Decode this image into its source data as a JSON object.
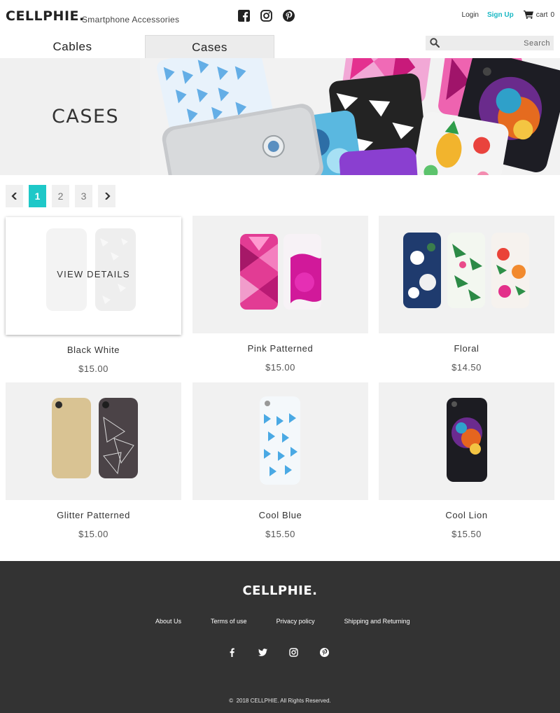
{
  "brand": {
    "name": "CELLPHIE.",
    "tagline": "Smartphone Accessories"
  },
  "header": {
    "social_icons": [
      "facebook-icon",
      "instagram-icon",
      "pinterest-icon"
    ],
    "login_label": "Login",
    "signup_label": "Sign Up",
    "cart_label": "cart",
    "cart_count": "0"
  },
  "tabs": [
    {
      "label": "Cables",
      "active": false
    },
    {
      "label": "Cases",
      "active": true
    }
  ],
  "search": {
    "placeholder": "Search",
    "value": ""
  },
  "banner": {
    "title": "CASES"
  },
  "pagination": {
    "pages": [
      "1",
      "2",
      "3"
    ],
    "current": "1"
  },
  "products": [
    {
      "name": "Black White",
      "price": "$15.00",
      "hover_label": "VIEW DETAILS"
    },
    {
      "name": "Pink Patterned",
      "price": "$15.00"
    },
    {
      "name": "Floral",
      "price": "$14.50"
    },
    {
      "name": "Glitter Patterned",
      "price": "$15.00"
    },
    {
      "name": "Cool Blue",
      "price": "$15.50"
    },
    {
      "name": "Cool Lion",
      "price": "$15.50"
    }
  ],
  "footer": {
    "brand": "CELLPHIE.",
    "links": [
      "About Us",
      "Terms of use",
      "Privacy policy",
      "Shipping and Returning"
    ],
    "social_icons": [
      "facebook-icon",
      "twitter-icon",
      "instagram-icon",
      "pinterest-icon"
    ],
    "copyright": "2018 CELLPHIE. All Rights Reserved."
  },
  "colors": {
    "accent": "#1ec8c8",
    "signup": "#1bb8c4",
    "footer_bg": "#333333"
  }
}
